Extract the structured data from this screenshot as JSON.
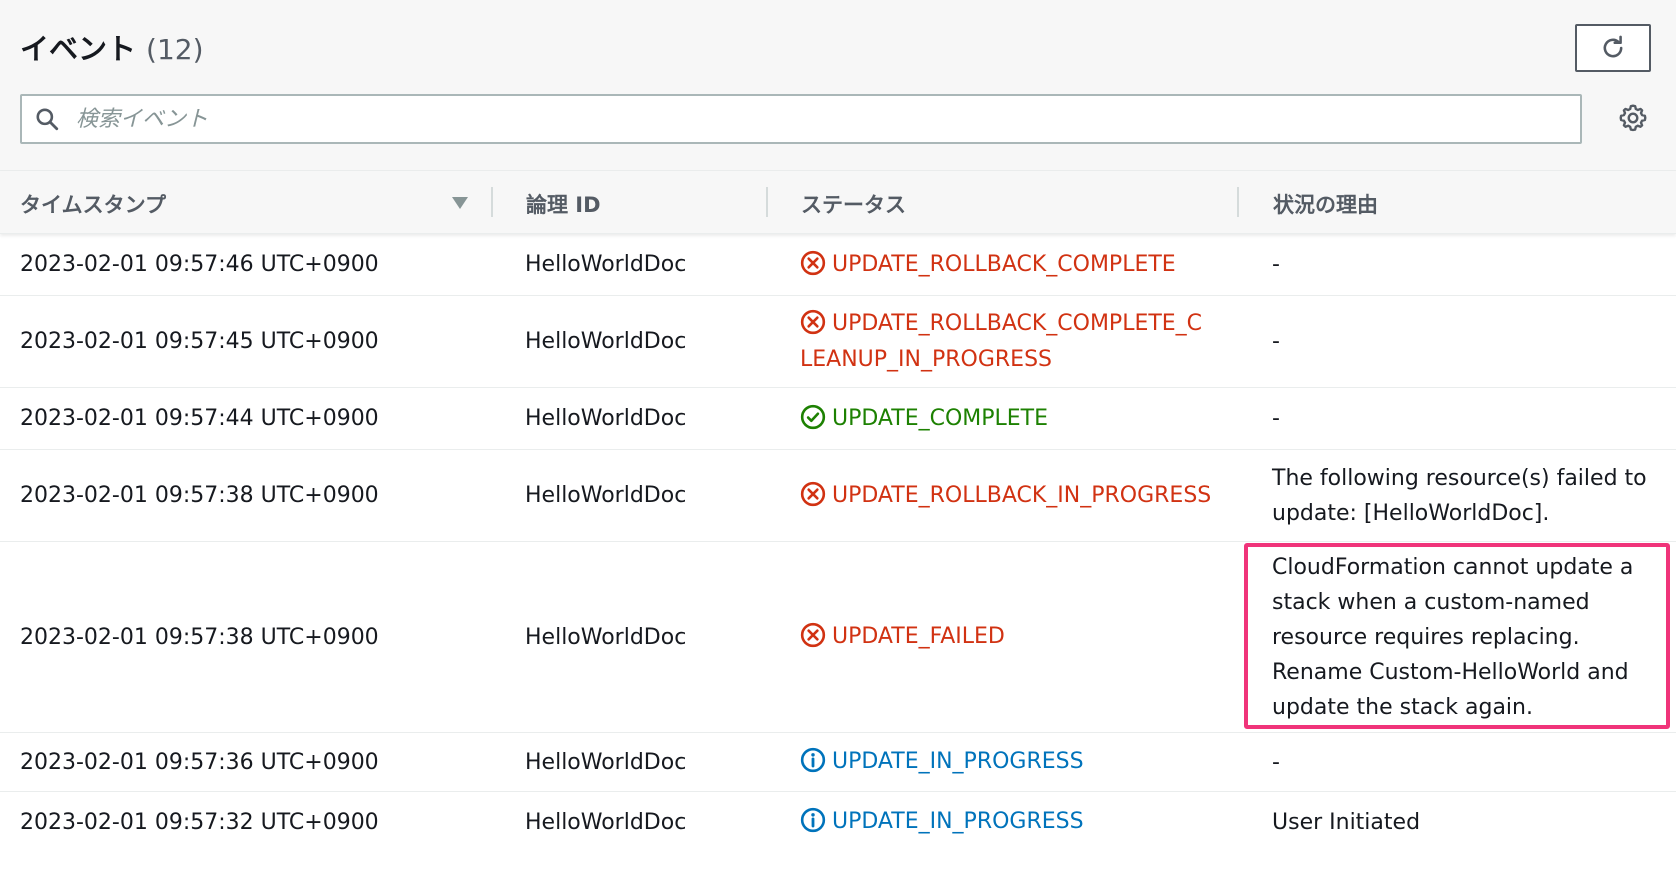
{
  "header": {
    "title": "イベント",
    "count": "(12)"
  },
  "search": {
    "placeholder": "検索イベント"
  },
  "table": {
    "columns": {
      "timestamp": "タイムスタンプ",
      "logical_id": "論理 ID",
      "status": "ステータス",
      "reason": "状況の理由"
    },
    "rows": [
      {
        "timestamp": "2023-02-01 09:57:46 UTC+0900",
        "logical_id": "HelloWorldDoc",
        "status": "UPDATE_ROLLBACK_COMPLETE",
        "status_type": "error",
        "reason": "-"
      },
      {
        "timestamp": "2023-02-01 09:57:45 UTC+0900",
        "logical_id": "HelloWorldDoc",
        "status": "UPDATE_ROLLBACK_COMPLETE_CLEANUP_IN_PROGRESS",
        "status_type": "error",
        "reason": "-"
      },
      {
        "timestamp": "2023-02-01 09:57:44 UTC+0900",
        "logical_id": "HelloWorldDoc",
        "status": "UPDATE_COMPLETE",
        "status_type": "success",
        "reason": "-"
      },
      {
        "timestamp": "2023-02-01 09:57:38 UTC+0900",
        "logical_id": "HelloWorldDoc",
        "status": "UPDATE_ROLLBACK_IN_PROGRESS",
        "status_type": "error",
        "reason": "The following resource(s) failed to update: [HelloWorldDoc]."
      },
      {
        "timestamp": "2023-02-01 09:57:38 UTC+0900",
        "logical_id": "HelloWorldDoc",
        "status": "UPDATE_FAILED",
        "status_type": "error",
        "reason": "CloudFormation cannot update a stack when a custom-named resource requires replacing. Rename Custom-HelloWorld and update the stack again."
      },
      {
        "timestamp": "2023-02-01 09:57:36 UTC+0900",
        "logical_id": "HelloWorldDoc",
        "status": "UPDATE_IN_PROGRESS",
        "status_type": "info",
        "reason": "-"
      },
      {
        "timestamp": "2023-02-01 09:57:32 UTC+0900",
        "logical_id": "HelloWorldDoc",
        "status": "UPDATE_IN_PROGRESS",
        "status_type": "info",
        "reason": "User Initiated"
      }
    ]
  },
  "colors": {
    "error": "#d13212",
    "success": "#1d8102",
    "info": "#0073bb",
    "highlight": "#f0347a"
  },
  "icons": {
    "refresh": "refresh-icon",
    "search": "search-icon",
    "settings": "gear-icon",
    "sort": "sort-descending-icon",
    "error": "x-circle-icon",
    "success": "check-circle-icon",
    "info": "info-circle-icon"
  }
}
